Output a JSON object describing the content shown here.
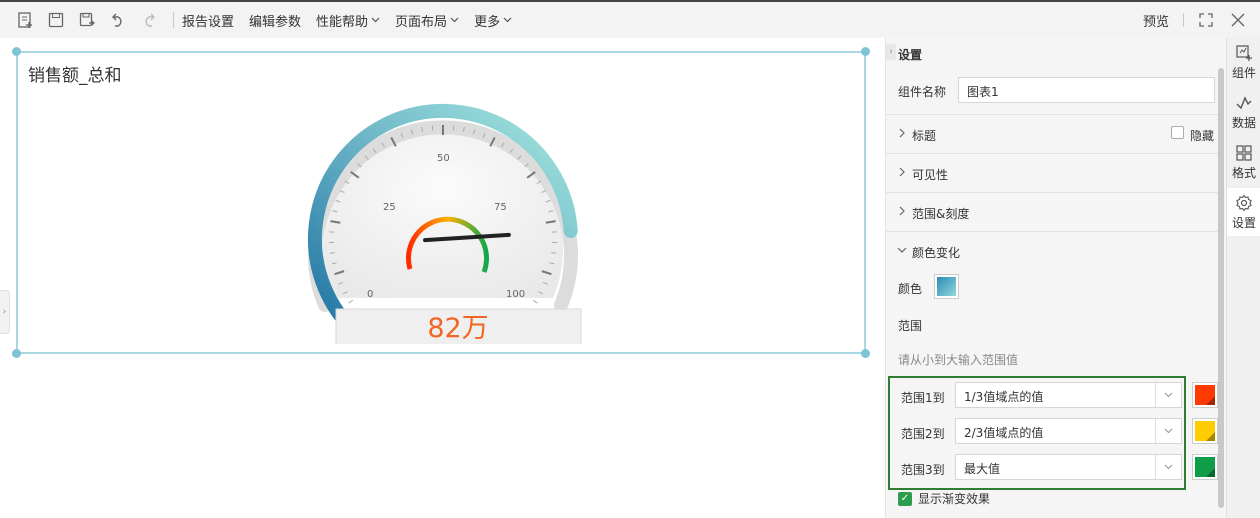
{
  "toolbar": {
    "menus": [
      {
        "label": "报告设置",
        "caret": false
      },
      {
        "label": "编辑参数",
        "caret": false
      },
      {
        "label": "性能帮助",
        "caret": true
      },
      {
        "label": "页面布局",
        "caret": true
      },
      {
        "label": "更多",
        "caret": true
      }
    ],
    "preview_label": "预览"
  },
  "widget": {
    "title": "销售额_总和",
    "gauge": {
      "min": 0,
      "max": 100,
      "ticks": [
        "0",
        "25",
        "50",
        "75",
        "100"
      ],
      "value_text": "82万",
      "pointer_percent": 82
    }
  },
  "panel": {
    "title": "设置",
    "component_name_label": "组件名称",
    "component_name_value": "图表1",
    "sections": {
      "title": "标题",
      "hide": "隐藏",
      "visibility": "可见性",
      "range_scale": "范围&刻度",
      "color_change": "颜色变化"
    },
    "color_label": "颜色",
    "range_label": "范围",
    "range_hint": "请从小到大输入范围值",
    "ranges": [
      {
        "label": "范围1到",
        "value": "1/3值域点的值",
        "color": "#ff3a00"
      },
      {
        "label": "范围2到",
        "value": "2/3值域点的值",
        "color": "#ffcc00"
      },
      {
        "label": "范围3到",
        "value": "最大值",
        "color": "#0f9d48"
      }
    ],
    "gradient_label": "显示渐变效果"
  },
  "rail": [
    {
      "label": "组件",
      "icon": "component-icon"
    },
    {
      "label": "数据",
      "icon": "data-icon"
    },
    {
      "label": "格式",
      "icon": "format-icon"
    },
    {
      "label": "设置",
      "icon": "settings-icon"
    }
  ]
}
